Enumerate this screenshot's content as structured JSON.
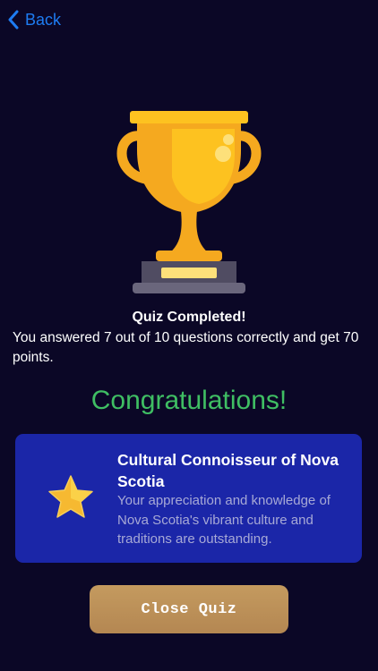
{
  "nav": {
    "back_label": "Back",
    "back_icon": "chevron-left-icon",
    "accent_color": "#1e7cf2"
  },
  "result": {
    "title": "Quiz Completed!",
    "message": "You answered 7 out of 10 questions correctly and get 70 points.",
    "correct": 7,
    "total": 10,
    "points": 70,
    "trophy_icon": "trophy-icon"
  },
  "congrats": {
    "text": "Congratulations!",
    "color": "#3fbe63"
  },
  "badge": {
    "icon": "star-icon",
    "title": "Cultural Connoisseur of Nova Scotia",
    "description": "Your appreciation and knowledge of Nova Scotia's vibrant culture and traditions are outstanding.",
    "card_color": "#1b26a8"
  },
  "actions": {
    "close_label": "Close Quiz",
    "close_color": "#c49a5f"
  },
  "theme": {
    "background": "#0b0726"
  }
}
